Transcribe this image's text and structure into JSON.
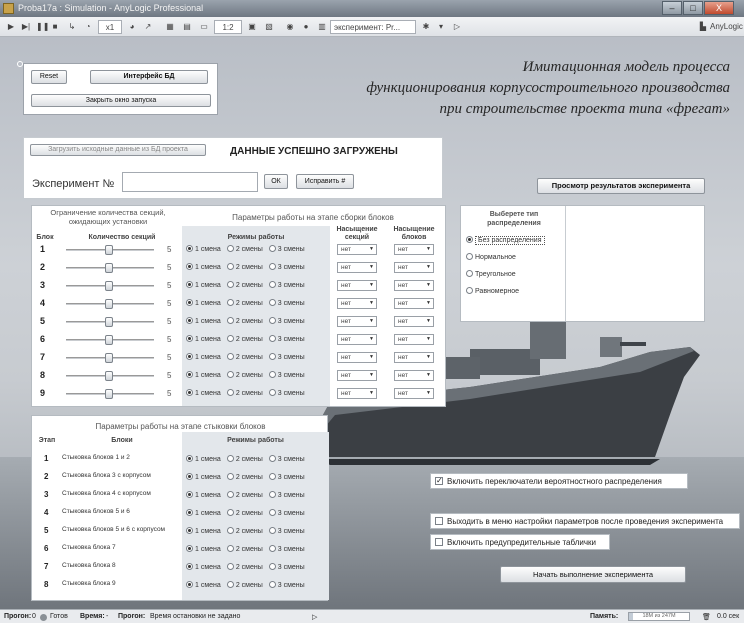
{
  "window": {
    "title": "Proba17a : Simulation - AnyLogic Professional",
    "min": "–",
    "max": "□",
    "close": "X"
  },
  "toolbar": {
    "speed": "x1",
    "scale": "1:2",
    "experiment": "эксперимент: Pr...",
    "brand": "AnyLogic"
  },
  "heading": {
    "line1": "Имитационная модель процесса",
    "line2": "функционирования корпусостроительного производства",
    "line3": "при строительстве проекта типа «фрегат»"
  },
  "topbar": {
    "reset": "Reset",
    "db": "Интерфейс БД",
    "close_windows": "Закрыть окно запуска"
  },
  "load": {
    "button": "Загрузить исходные данные из БД проекта",
    "status": "ДАННЫЕ УСПЕШНО ЗАГРУЖЕНЫ",
    "exp_label": "Эксперимент №",
    "ok": "ОК",
    "fix": "Исправить #"
  },
  "view_results": "Просмотр результатов эксперимента",
  "assembly": {
    "limit_header": "Ограничение количества секций, ожидающих установки",
    "params_header": "Параметры работы на этапе сборки блоков",
    "col_block": "Блок",
    "col_count": "Количество секций",
    "col_modes": "Режимы работы",
    "col_sat_sections": "Насыщение секций",
    "col_sat_blocks": "Насыщение блоков",
    "modes": [
      "1 смена",
      "2 смены",
      "3 смены"
    ],
    "rows": [
      {
        "n": "1",
        "count": "5",
        "mode": "1 смена",
        "s1": "нет",
        "s2": "нет"
      },
      {
        "n": "2",
        "count": "5",
        "mode": "1 смена",
        "s1": "нет",
        "s2": "нет"
      },
      {
        "n": "3",
        "count": "5",
        "mode": "1 смена",
        "s1": "нет",
        "s2": "нет"
      },
      {
        "n": "4",
        "count": "5",
        "mode": "1 смена",
        "s1": "нет",
        "s2": "нет"
      },
      {
        "n": "5",
        "count": "5",
        "mode": "1 смена",
        "s1": "нет",
        "s2": "нет"
      },
      {
        "n": "6",
        "count": "5",
        "mode": "1 смена",
        "s1": "нет",
        "s2": "нет"
      },
      {
        "n": "7",
        "count": "5",
        "mode": "1 смена",
        "s1": "нет",
        "s2": "нет"
      },
      {
        "n": "8",
        "count": "5",
        "mode": "1 смена",
        "s1": "нет",
        "s2": "нет"
      },
      {
        "n": "9",
        "count": "5",
        "mode": "1 смена",
        "s1": "нет",
        "s2": "нет"
      }
    ]
  },
  "distribution": {
    "title": "Выберете тип распределения",
    "options": [
      "Без распределения",
      "Нормальное",
      "Треугольное",
      "Равномерное"
    ],
    "selected": "Без распределения"
  },
  "docking": {
    "header": "Параметры работы на этапе стыковки блоков",
    "col_stage": "Этап",
    "col_blocks": "Блоки",
    "col_modes": "Режимы работы",
    "rows": [
      {
        "n": "1",
        "name": "Стыковка блоков 1 и 2"
      },
      {
        "n": "2",
        "name": "Стыковка блока 3 с корпусом"
      },
      {
        "n": "3",
        "name": "Стыковка блока 4 с корпусом"
      },
      {
        "n": "4",
        "name": "Стыковка блоков 5 и 6"
      },
      {
        "n": "5",
        "name": "Стыковка блоков 5 и 6 с корпусом"
      },
      {
        "n": "6",
        "name": "Стыковка блока 7"
      },
      {
        "n": "7",
        "name": "Стыковка блока 8"
      },
      {
        "n": "8",
        "name": "Стыковка блока 9"
      }
    ]
  },
  "options": {
    "enable_switches": "Включить переключатели вероятностного распределения",
    "exit_menu": "Выходить в меню настройки параметров после проведения эксперимента",
    "warnings": "Включить предупредительные таблички",
    "start": "Начать выполнение эксперимента"
  },
  "status": {
    "run1_label": "Прогон:",
    "run1_value": "0",
    "ready": "Готов",
    "time_label": "Время:",
    "time_value": "-",
    "run2_label": "Прогон:",
    "run2_value": "Время остановки не задано",
    "memory_label": "Память:",
    "memory_value": "18М из 247М",
    "memory_fraction": 0.07,
    "speed": "0.0 сек"
  }
}
